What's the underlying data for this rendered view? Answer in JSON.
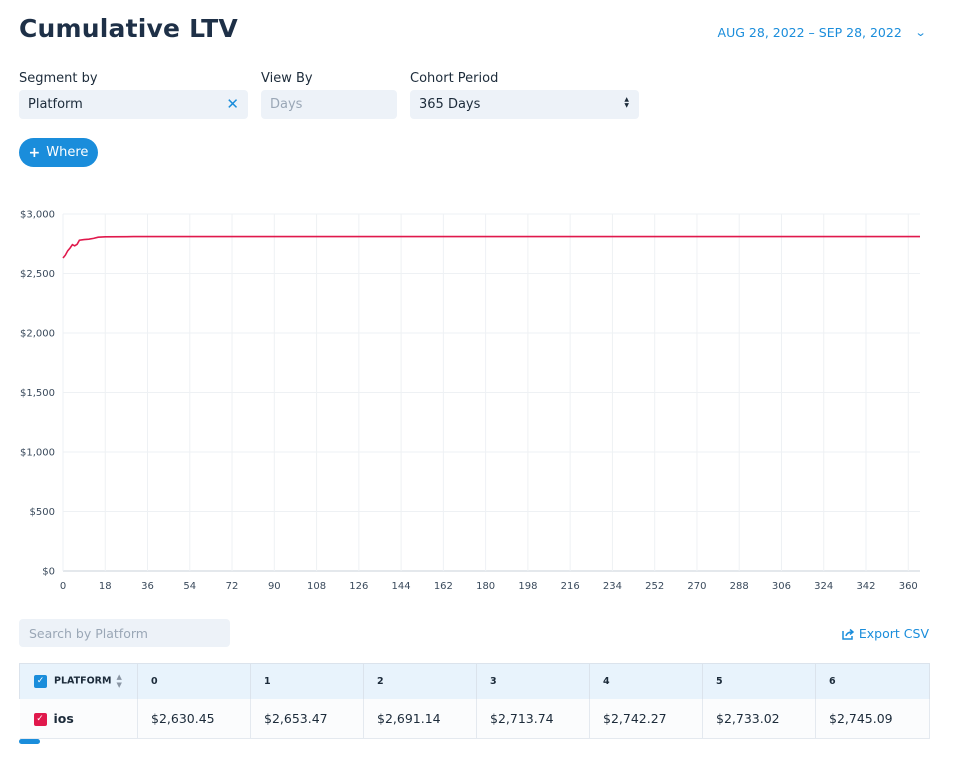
{
  "header": {
    "title": "Cumulative LTV",
    "date_range": "AUG 28, 2022  –  SEP 28, 2022"
  },
  "filters": {
    "segment_label": "Segment by",
    "segment_value": "Platform",
    "view_label": "View By",
    "view_placeholder": "Days",
    "cohort_label": "Cohort Period",
    "cohort_value": "365 Days",
    "where_label": "Where"
  },
  "colors": {
    "accent": "#1a8ddb",
    "series": "#e0194c"
  },
  "chart_data": {
    "type": "line",
    "title": "",
    "xlabel": "",
    "ylabel": "",
    "ylim": [
      0,
      3000
    ],
    "xlim": [
      0,
      365
    ],
    "y_ticks": [
      "$0",
      "$500",
      "$1,000",
      "$1,500",
      "$2,000",
      "$2,500",
      "$3,000"
    ],
    "x_ticks": [
      "0",
      "18",
      "36",
      "54",
      "72",
      "90",
      "108",
      "126",
      "144",
      "162",
      "180",
      "198",
      "216",
      "234",
      "252",
      "270",
      "288",
      "306",
      "324",
      "342",
      "360"
    ],
    "grid": true,
    "series": [
      {
        "color": "#e0194c",
        "points": [
          [
            0,
            2630.45
          ],
          [
            1,
            2653.47
          ],
          [
            2,
            2691.14
          ],
          [
            3,
            2713.74
          ],
          [
            4,
            2742.27
          ],
          [
            5,
            2733.02
          ],
          [
            6,
            2745.09
          ],
          [
            7,
            2780
          ],
          [
            9,
            2785
          ],
          [
            11,
            2788
          ],
          [
            13,
            2795
          ],
          [
            15,
            2805
          ],
          [
            18,
            2808
          ],
          [
            30,
            2810
          ],
          [
            365,
            2810
          ]
        ]
      }
    ]
  },
  "table": {
    "search_placeholder": "Search by Platform",
    "export_label": "Export CSV",
    "columns": [
      "PLATFORM",
      "0",
      "1",
      "2",
      "3",
      "4",
      "5",
      "6"
    ],
    "rows": [
      {
        "name": "ios",
        "values": [
          "$2,630.45",
          "$2,653.47",
          "$2,691.14",
          "$2,713.74",
          "$2,742.27",
          "$2,733.02",
          "$2,745.09"
        ]
      }
    ]
  }
}
